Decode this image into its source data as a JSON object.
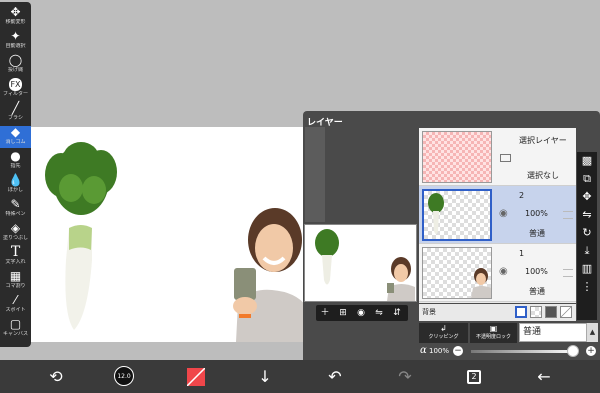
{
  "toolbar": {
    "tools": [
      {
        "label": "移動変形",
        "icon": "move-icon"
      },
      {
        "label": "自動選択",
        "icon": "magic-wand-icon"
      },
      {
        "label": "投げ縄",
        "icon": "lasso-icon"
      },
      {
        "label": "フィルター",
        "icon": "filter-icon"
      },
      {
        "label": "ブラシ",
        "icon": "brush-icon"
      },
      {
        "label": "消しゴム",
        "icon": "eraser-icon"
      },
      {
        "label": "指先",
        "icon": "finger-icon"
      },
      {
        "label": "ぼかし",
        "icon": "blur-icon"
      },
      {
        "label": "特殊ペン",
        "icon": "special-pen-icon"
      },
      {
        "label": "塗りつぶし",
        "icon": "fill-icon"
      },
      {
        "label": "文字入れ",
        "icon": "text-icon"
      },
      {
        "label": "コマ割り",
        "icon": "frame-divider-icon"
      },
      {
        "label": "スポイト",
        "icon": "eyedropper-icon"
      },
      {
        "label": "キャンバス",
        "icon": "canvas-icon"
      }
    ],
    "filter_badge": "FX"
  },
  "layer_panel": {
    "title": "レイヤー",
    "selection_layer": {
      "name": "選択レイヤー",
      "status": "選択なし"
    },
    "layers": [
      {
        "name": "2",
        "opacity": "100%",
        "mode": "普通",
        "selected": true
      },
      {
        "name": "1",
        "opacity": "100%",
        "mode": "普通",
        "selected": false
      }
    ],
    "background_label": "背景",
    "clipping_label": "クリッピング",
    "lock_label": "不透明度ロック",
    "blend_mode": "普通",
    "alpha_symbol": "α",
    "alpha_value": "100%",
    "alpha_fraction": 1.0
  },
  "bottombar": {
    "brush_size": "12.0",
    "color": "#f0464a"
  }
}
